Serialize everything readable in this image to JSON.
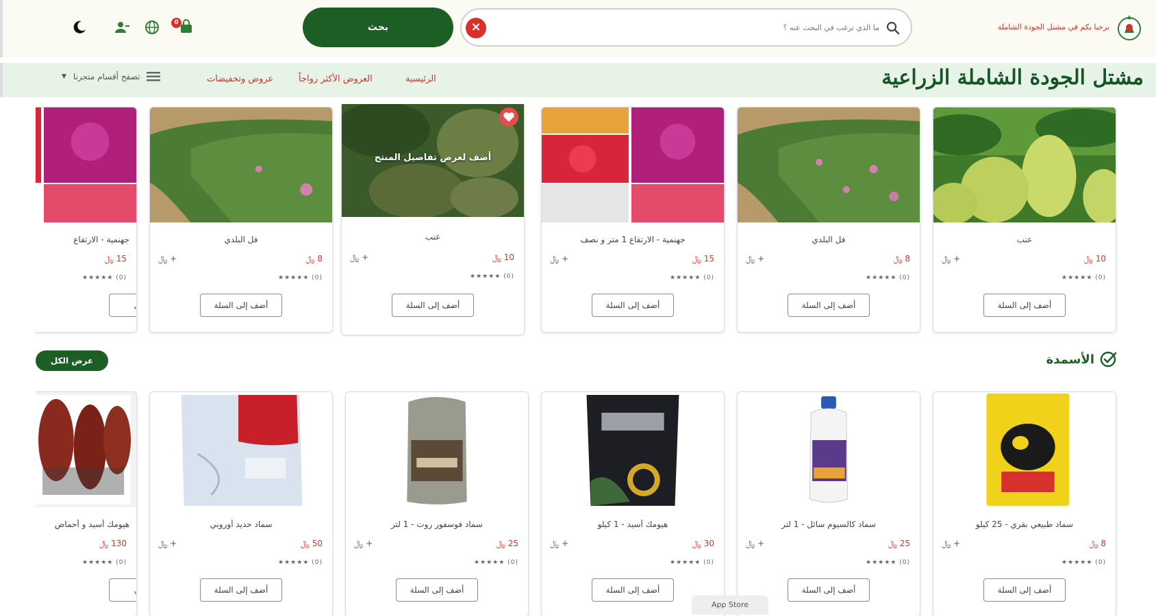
{
  "header": {
    "tagline": "نرحبا بكم في مشتل الجودة الشاملة",
    "search": {
      "placeholder": "ما الذي ترغب في البحث عنه ؟",
      "button_label": "بحث",
      "clear_icon": "close-icon"
    },
    "cart_count": "0",
    "icons": [
      "cart-icon",
      "globe-icon",
      "user-icon",
      "moon-icon"
    ]
  },
  "nav": {
    "brand": "مشتل الجودة الشاملة الزراعية",
    "links": [
      "الرئيسية",
      "العروض الأكثر رواجاً",
      "عروض وتخفيضات"
    ],
    "browse_label": "تصفح أقسام متجرنا"
  },
  "offers": {
    "cards": [
      {
        "name": "عنب",
        "price": "10",
        "qty": "+",
        "rating": "★★★★★ (0)",
        "add_label": "أضف إلى السلة",
        "image": "grapes",
        "overlay": ""
      },
      {
        "name": "فل البلدي",
        "price": "8",
        "qty": "+",
        "rating": "★★★★★ (0)",
        "add_label": "أضف إلى السلة",
        "image": "hedge",
        "overlay": ""
      },
      {
        "name": "جهنمية - الارتفاع 1 متر و نصف",
        "price": "15",
        "qty": "+",
        "rating": "★★★★★ (0)",
        "add_label": "أضف إلى السلة",
        "image": "flowers",
        "overlay": ""
      },
      {
        "name": "عنب",
        "price": "10",
        "qty": "+",
        "rating": "★★★★★ (0)",
        "add_label": "أضف إلى السلة",
        "image": "grapes-dark",
        "overlay": "أضف لعرض تفاصيل المنتج"
      },
      {
        "name": "فل البلدي",
        "price": "8",
        "qty": "+",
        "rating": "★★★★★ (0)",
        "add_label": "أضف إلى السلة",
        "image": "hedge",
        "overlay": ""
      },
      {
        "name": "جهنمية - الارتفاع",
        "price": "15",
        "qty": "",
        "rating": "★★★★★ (0)",
        "add_label": "أضف إلى",
        "image": "flowers-partial",
        "overlay": ""
      }
    ]
  },
  "fertilizers": {
    "title": "الأسمدة",
    "view_all_label": "عرض الكل",
    "cards": [
      {
        "name": "سماد طبيعي بقري - 25 كيلو",
        "price": "8",
        "qty": "+",
        "rating": "★★★★★ (0)",
        "add_label": "أضف إلى السلة",
        "image": "cow-bag"
      },
      {
        "name": "سماد كالسيوم سائل - 1 لتر",
        "price": "25",
        "qty": "+",
        "rating": "★★★★★ (0)",
        "add_label": "أضف إلى السلة",
        "image": "bottle-white"
      },
      {
        "name": "هيومك أسيد - 1 كيلو",
        "price": "30",
        "qty": "+",
        "rating": "★★★★★ (0)",
        "add_label": "أضف إلى السلة",
        "image": "black-bag"
      },
      {
        "name": "سماد فوسفور روت - 1 لتر",
        "price": "25",
        "qty": "+",
        "rating": "★★★★★ (0)",
        "add_label": "أضف إلى السلة",
        "image": "bottle-grey"
      },
      {
        "name": "سماد حديد أوروبي",
        "price": "50",
        "qty": "+",
        "rating": "★★★★★ (0)",
        "add_label": "أضف إلى السلة",
        "image": "white-bag"
      },
      {
        "name": "هيومك أسيد و أحماض",
        "price": "130",
        "qty": "",
        "rating": "★★★★★ (0)",
        "add_label": "أضف إلى",
        "image": "dates"
      }
    ]
  },
  "footer": {
    "appstore_label": "App Store"
  },
  "colors": {
    "brand_green": "#1d5e25",
    "accent_red": "#d8302c",
    "nav_bg": "#e8f3e8"
  }
}
